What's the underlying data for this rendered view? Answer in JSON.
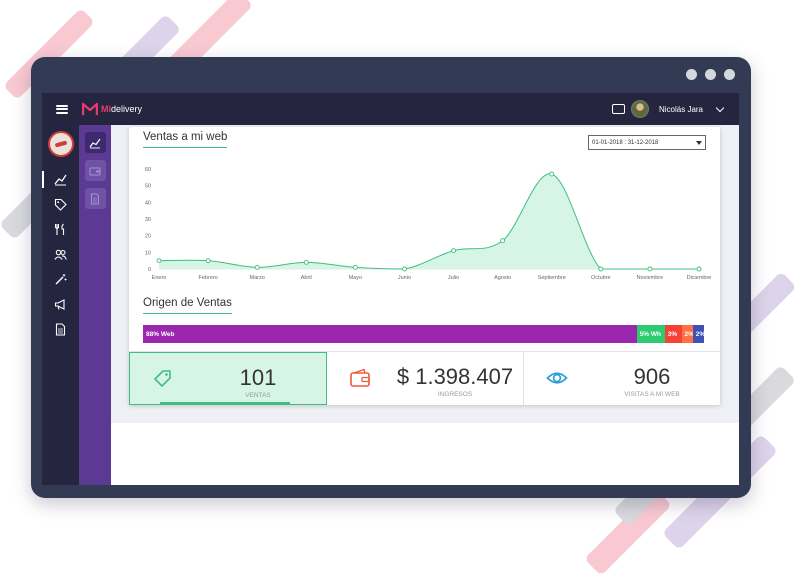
{
  "app": {
    "brand_prefix": "Mi",
    "brand_suffix": "delivery"
  },
  "user": {
    "name": "Nicolás Jara"
  },
  "colors": {
    "accent": "#3fbf7f",
    "nav": "#252540",
    "subnav": "#5c3a93",
    "fill": "#d6f5e6"
  },
  "sidebar": {
    "items": [
      {
        "icon": "sales-chart-icon",
        "active": true
      },
      {
        "icon": "tag-icon",
        "active": false
      },
      {
        "icon": "utensils-icon",
        "active": false
      },
      {
        "icon": "users-icon",
        "active": false
      },
      {
        "icon": "magic-wand-icon",
        "active": false
      },
      {
        "icon": "megaphone-icon",
        "active": false
      },
      {
        "icon": "document-icon",
        "active": false
      }
    ]
  },
  "subsidebar": {
    "items": [
      {
        "icon": "chart-icon",
        "active": true
      },
      {
        "icon": "wallet-icon",
        "active": false
      },
      {
        "icon": "file-icon",
        "active": false
      }
    ]
  },
  "sales_chart": {
    "title": "Ventas a mi web",
    "date_range": "01-01-2018 : 31-12-2018"
  },
  "chart_data": {
    "type": "area",
    "title": "Ventas a mi web",
    "categories": [
      "Enero",
      "Febrero",
      "Marzo",
      "Abril",
      "Mayo",
      "Junio",
      "Julio",
      "Agosto",
      "Septiembre",
      "Octubre",
      "Noviembre",
      "Diciembre"
    ],
    "series": [
      {
        "values": [
          5,
          5,
          1,
          4,
          1,
          0,
          11,
          17,
          57,
          0,
          0,
          0
        ]
      }
    ],
    "yticks": [
      0,
      10,
      20,
      30,
      40,
      50,
      60
    ],
    "ylim": [
      0,
      60
    ],
    "grid": false
  },
  "origin": {
    "title": "Origen de Ventas",
    "segments": [
      {
        "label": "88% Web",
        "share": 88,
        "color": "#9b27af"
      },
      {
        "label": "5% Wh",
        "share": 5,
        "color": "#2ecc71"
      },
      {
        "label": "3%",
        "share": 3,
        "color": "#f44336"
      },
      {
        "label": "2%",
        "share": 2,
        "color": "#ff7043"
      },
      {
        "label": "2%",
        "share": 2,
        "color": "#3f51b5"
      }
    ]
  },
  "stats": [
    {
      "value": "101",
      "label": "VENTAS",
      "icon": "tag-icon"
    },
    {
      "value": "$ 1.398.407",
      "label": "INGRESOS",
      "icon": "wallet-icon"
    },
    {
      "value": "906",
      "label": "VISITAS A MI WEB",
      "icon": "eye-icon"
    }
  ]
}
